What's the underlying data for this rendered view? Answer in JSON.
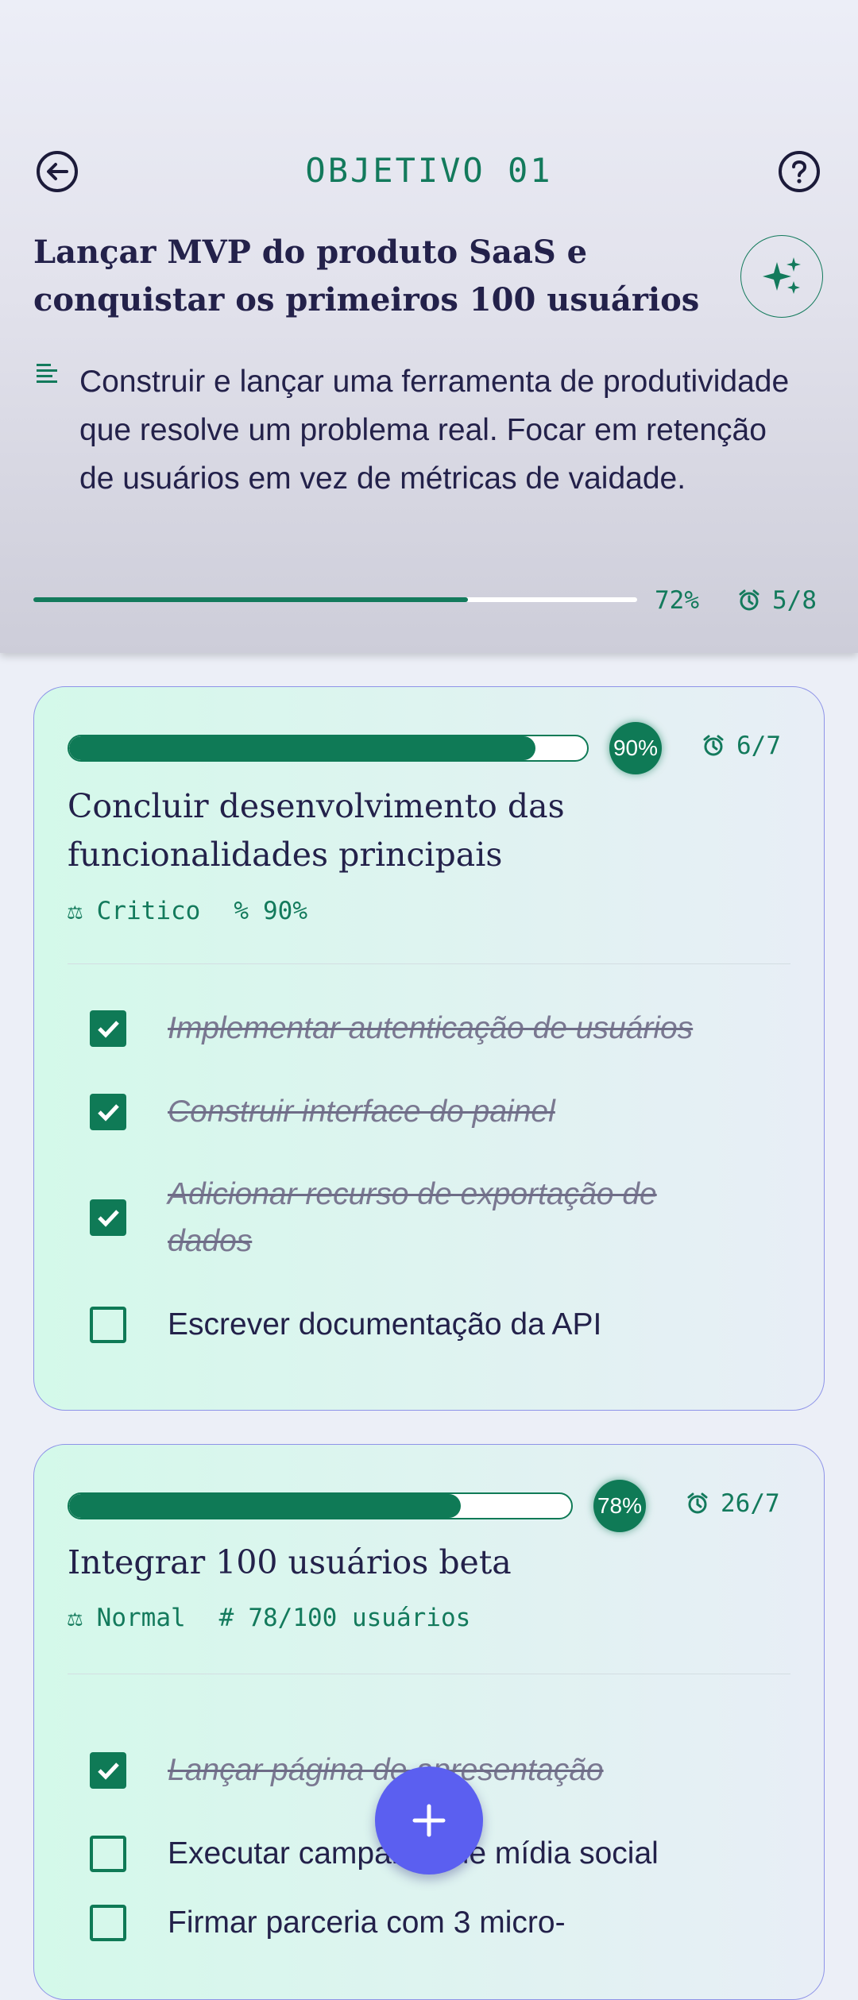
{
  "header": {
    "title": "OBJETIVO 01",
    "goal_title": "Lançar MVP do produto SaaS e conquistar os primeiros 100 usuários",
    "description": "Construir e lançar uma ferramenta de produtividade que resolve um problema real. Focar em retenção de usuários em vez de métricas de vaidade.",
    "progress": 0.72,
    "progress_label": "72%",
    "count_label": "5/8",
    "icons": [
      "back-arrow-icon",
      "help-icon",
      "sparkles-icon",
      "description-lines-icon",
      "alarm-clock-icon"
    ]
  },
  "key_results": [
    {
      "progress": 0.9,
      "percent_label": "90%",
      "count_label": "6/7",
      "title": "Concluir desenvolvimento das funcionalidades principais",
      "meta1_symbol": "⚖",
      "meta1": "Critico",
      "meta2_symbol": "%",
      "meta2": "90%",
      "tasks": [
        {
          "text": "Implementar autenticação de usuários",
          "done": true
        },
        {
          "text": "Construir interface do painel",
          "done": true
        },
        {
          "text": "Adicionar recurso de exportação de dados",
          "done": true
        },
        {
          "text": "Escrever documentação da API",
          "done": false
        }
      ]
    },
    {
      "progress": 0.78,
      "percent_label": "78%",
      "count_label": "26/7",
      "title": "Integrar 100 usuários beta",
      "meta1_symbol": "⚖",
      "meta1": "Normal",
      "meta2_symbol": "#",
      "meta2": "78/100 usuários",
      "tasks": [
        {
          "text": "Lançar página de apresentação",
          "done": true
        },
        {
          "text": "Executar campanha de mídia social",
          "done": false
        },
        {
          "text": "Firmar parceria com 3 micro-",
          "done": false
        }
      ]
    }
  ],
  "fab": {
    "label": "+"
  },
  "colors": {
    "accent": "#0f7a56",
    "fab": "#5b5ff0",
    "text": "#23214a",
    "card_border": "#8e93e8"
  }
}
